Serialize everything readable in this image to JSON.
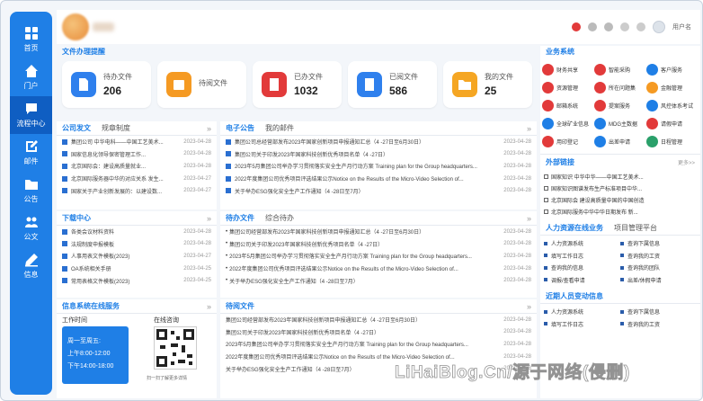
{
  "sidebar": {
    "items": [
      {
        "label": "首页"
      },
      {
        "label": "门户"
      },
      {
        "label": "流程中心"
      },
      {
        "label": "邮件"
      },
      {
        "label": "公告"
      },
      {
        "label": "公文"
      },
      {
        "label": "信息"
      }
    ]
  },
  "stats_title": "文件办理提醒",
  "stats": [
    {
      "label": "待办文件",
      "value": "206",
      "color": "#2f80ed"
    },
    {
      "label": "待阅文件",
      "value": "",
      "color": "#f59a23"
    },
    {
      "label": "已办文件",
      "value": "1032",
      "color": "#e23a3a"
    },
    {
      "label": "已阅文件",
      "value": "586",
      "color": "#2f80ed"
    },
    {
      "label": "我的文件",
      "value": "25",
      "color": "#f5a623"
    }
  ],
  "company": {
    "tabs": [
      "公司发文",
      "规章制度"
    ],
    "rows": [
      {
        "t": "集团公司 中华电科——中国工艺美术...",
        "d": "2023-04-28"
      },
      {
        "t": "国家信息化领导保密管理工作...",
        "d": "2023-04-28"
      },
      {
        "t": "北京国际会：建设高质量就业... ",
        "d": "2023-04-28"
      },
      {
        "t": "北京国际服务器中华的对应关系 发生...",
        "d": "2023-04-27"
      },
      {
        "t": "国家关于产业创新发展的：以建设数...",
        "d": "2023-04-27"
      }
    ]
  },
  "download": {
    "title": "下载中心",
    "rows": [
      {
        "t": "各类会议材料资料",
        "d": "2023-04-28"
      },
      {
        "t": "法规制度申报模板",
        "d": "2023-04-28"
      },
      {
        "t": "人事用表文件模板(2023)",
        "d": "2023-04-27"
      },
      {
        "t": "OA系统相关手册",
        "d": "2023-04-25"
      },
      {
        "t": "常用表格文件模板(2023)",
        "d": "2023-04-25"
      }
    ]
  },
  "mobile": {
    "title": "信息系统在线服务",
    "worktime_label": "工作时间",
    "qr_label": "在线咨询",
    "days": "周一至周五:",
    "am": "上午8:00-12:00",
    "pm": "下午14:00-18:00",
    "scan_hint": "扫一扫了解更多详情"
  },
  "notice": {
    "tabs": [
      "电子公告",
      "我的邮件"
    ],
    "rows": [
      {
        "t": "集团公司总经营部发布2023年国家创新项目申报通知汇总（4 -27日至6月30日）",
        "d": "2023-04-28"
      },
      {
        "t": "集团公司关于印发2023年国家科技创新优秀项目名单（4 -27日）",
        "d": "2023-04-28"
      },
      {
        "t": "2023年5月集团公司举办学习贯彻落实安全生产月行动方案 Training plan for the Group headquarters...",
        "d": "2023-04-28"
      },
      {
        "t": "2022年度集团公司优秀项目评选结果公示Notice on the Results of the Micro-Video Selection of...",
        "d": "2023-04-28"
      },
      {
        "t": "关于举办ESG强化安全生产工作通知（4 -28日至7月）",
        "d": "2023-04-28"
      }
    ]
  },
  "todo": {
    "tabs": [
      "待办文件",
      "综合待办"
    ],
    "rows": [
      {
        "t": "集团公司经营部发布2023年国家科技创新项目申报通知汇总（4 -27日至6月30日）",
        "d": "2023-04-28"
      },
      {
        "t": "集团公司关于印发2023年国家科技创新优秀项目名单（4 -27日）",
        "d": "2023-04-28"
      },
      {
        "t": "2023年5月集团公司举办学习贯彻落实安全生产月行动方案 Training plan for the Group headquarters...",
        "d": "2023-04-28"
      },
      {
        "t": "2022年度集团公司优秀项目评选结果公示Notice on the Results of the Micro-Video Selection of...",
        "d": "2023-04-28"
      },
      {
        "t": "关于举办ESG强化安全生产工作通知（4 -28日至7月）",
        "d": "2023-04-28"
      }
    ]
  },
  "read": {
    "title": "待阅文件",
    "rows": [
      {
        "t": "集团公司经营部发布2023年国家科技创新项目申报通知汇总（4 -27日至6月30日）",
        "d": "2023-04-28"
      },
      {
        "t": "集团公司关于印发2023年国家科技创新优秀项目名单（4 -27日）",
        "d": "2023-04-28"
      },
      {
        "t": "2023年5月集团公司举办学习贯彻落实安全生产月行动方案 Training plan for the Group headquarters...",
        "d": "2023-04-28"
      },
      {
        "t": "2022年度集团公司优秀项目评选结果公示Notice on the Results of the Micro-Video Selection of...",
        "d": "2023-04-28"
      },
      {
        "t": "关于举办ESG强化安全生产工作通知（4 -28日至7月）",
        "d": "2023-04-28"
      }
    ]
  },
  "business": {
    "title": "业务系统",
    "items": [
      {
        "l": "财务共享",
        "c": "#e23a3a"
      },
      {
        "l": "智能采购",
        "c": "#e23a3a"
      },
      {
        "l": "客户服务",
        "c": "#1f7fe6"
      },
      {
        "l": "资源管理",
        "c": "#e23a3a"
      },
      {
        "l": "所在问题集",
        "c": "#e23a3a"
      },
      {
        "l": "金融管理",
        "c": "#f59a23"
      },
      {
        "l": "邮箱系统",
        "c": "#e23a3a"
      },
      {
        "l": "提案服务",
        "c": "#e23a3a"
      },
      {
        "l": "风控体系考试",
        "c": "#1f7fe6"
      },
      {
        "l": "全球矿业信息",
        "c": "#1f7fe6"
      },
      {
        "l": "MDG主数据",
        "c": "#1f7fe6"
      },
      {
        "l": "请假申请",
        "c": "#e23a3a"
      },
      {
        "l": "用印登记",
        "c": "#e23a3a"
      },
      {
        "l": "出差申请",
        "c": "#1f7fe6"
      },
      {
        "l": "日程管理",
        "c": "#2aa06a"
      }
    ]
  },
  "external": {
    "title": "外部链接",
    "more": "更多>>",
    "rows": [
      "国家知识 中华中华——中国工艺美术...",
      "国家知识图谱发布生产标准项目中华...",
      "北京国际会 建设高质量中国的中国创造",
      "北京国际服务中华中华日期发布 新..."
    ]
  },
  "hr": {
    "tabs": [
      "人力资源在线业务",
      "项目管理平台"
    ],
    "items": [
      "人力资源系统",
      "查询下属信息",
      "填写工作日志",
      "查询我的工资",
      "查询我的信息",
      "查询我的团队",
      "调报/查看申请",
      "出差/休假申请"
    ]
  },
  "recent": {
    "title": "近期人员变动信息",
    "items": [
      "人力资源系统",
      "查询下属信息",
      "填写工作日志",
      "查询我的工资"
    ]
  },
  "user": {
    "name": "用户名"
  },
  "watermark": "LiHaiBlog.Cn/源于网络(侵删)"
}
